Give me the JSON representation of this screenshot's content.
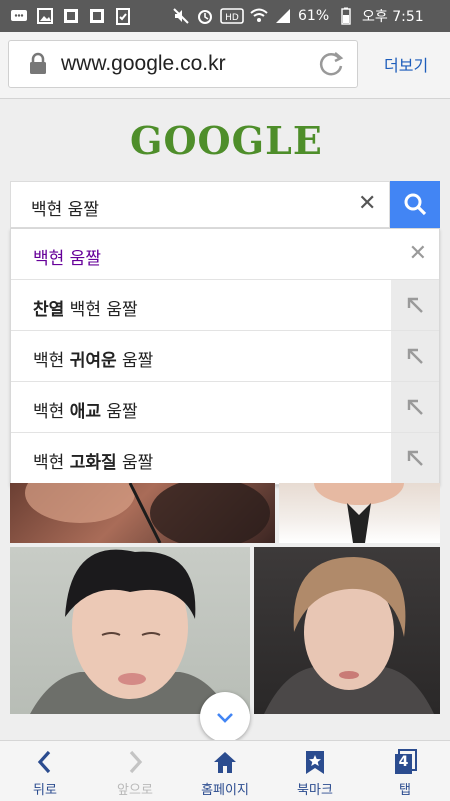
{
  "status_bar": {
    "battery": "61%",
    "time": "오후 7:51",
    "icons": [
      "message-icon",
      "image-icon",
      "app-icon",
      "app-icon",
      "clipboard-icon",
      "mute-icon",
      "alarm-icon",
      "hd-icon",
      "wifi-icon",
      "signal-icon",
      "battery-icon"
    ]
  },
  "browser": {
    "url": "www.google.co.kr",
    "more_label": "더보기"
  },
  "page": {
    "logo_text": "GOOGLE",
    "search_query": "백현 움짤",
    "search_button_icon": "search-icon",
    "suggestions": [
      {
        "prefix": "",
        "bold": "",
        "suffix": "백현 움짤",
        "type": "history"
      },
      {
        "prefix": "",
        "bold": "찬열",
        "suffix": " 백현 움짤",
        "type": "suggest"
      },
      {
        "prefix": "백현 ",
        "bold": "귀여운",
        "suffix": " 움짤",
        "type": "suggest"
      },
      {
        "prefix": "백현 ",
        "bold": "애교",
        "suffix": " 움짤",
        "type": "suggest"
      },
      {
        "prefix": "백현 ",
        "bold": "고화질",
        "suffix": " 움짤",
        "type": "suggest"
      }
    ]
  },
  "bottom_nav": [
    {
      "label": "뒤로",
      "icon": "back-icon",
      "enabled": true
    },
    {
      "label": "앞으로",
      "icon": "forward-icon",
      "enabled": false
    },
    {
      "label": "홈페이지",
      "icon": "home-icon",
      "enabled": true
    },
    {
      "label": "북마크",
      "icon": "bookmark-icon",
      "enabled": true
    },
    {
      "label": "탭",
      "icon": "tabs-icon",
      "enabled": true,
      "count": "4"
    }
  ],
  "colors": {
    "accent": "#4285f4",
    "history_text": "#660099",
    "nav_text": "#2b4c8f",
    "logo_green": "#4e8e2a"
  }
}
